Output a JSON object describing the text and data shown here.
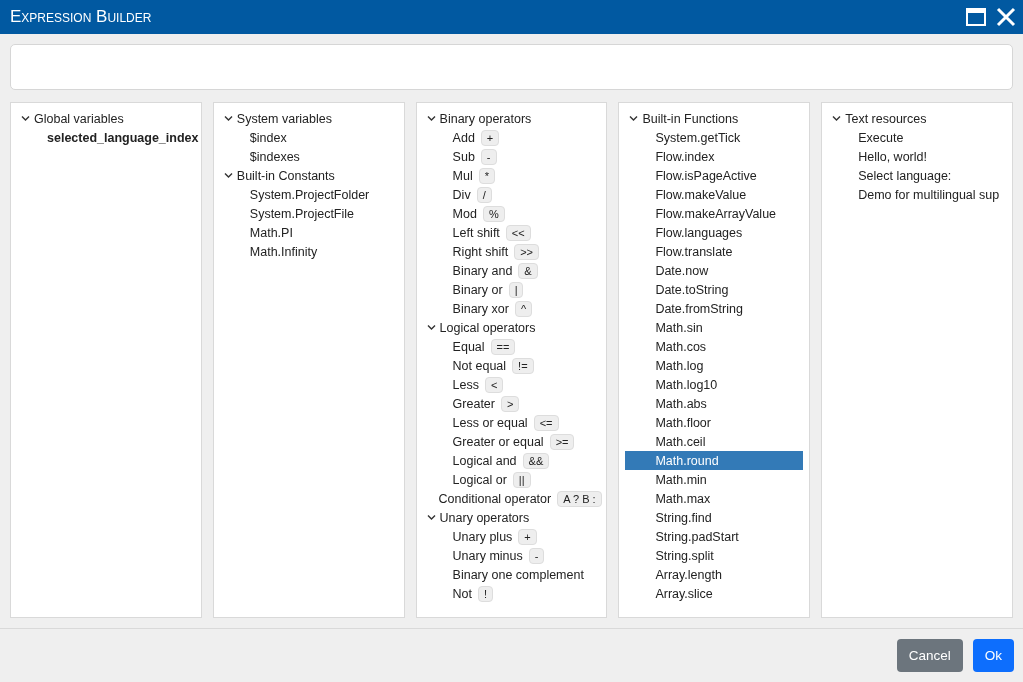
{
  "window": {
    "title": "Expression Builder"
  },
  "panels": [
    {
      "items": [
        {
          "label": "Global variables",
          "expanded": true,
          "children": [
            {
              "label": "selected_language_index",
              "kind": "variable",
              "selected": false
            }
          ]
        }
      ]
    },
    {
      "items": [
        {
          "label": "System variables",
          "expanded": true,
          "children": [
            {
              "label": "$index",
              "selected": false
            },
            {
              "label": "$indexes",
              "selected": false
            }
          ]
        },
        {
          "label": "Built-in Constants",
          "expanded": true,
          "children": [
            {
              "label": "System.ProjectFolder",
              "selected": false
            },
            {
              "label": "System.ProjectFile",
              "selected": false
            },
            {
              "label": "Math.PI",
              "selected": false
            },
            {
              "label": "Math.Infinity",
              "selected": false
            }
          ]
        }
      ]
    },
    {
      "items": [
        {
          "label": "Binary operators",
          "expanded": true,
          "children": [
            {
              "label": "Add",
              "operator": "+",
              "selected": false
            },
            {
              "label": "Sub",
              "operator": "-",
              "selected": false
            },
            {
              "label": "Mul",
              "operator": "*",
              "selected": false
            },
            {
              "label": "Div",
              "operator": "/",
              "selected": false
            },
            {
              "label": "Mod",
              "operator": "%",
              "selected": false
            },
            {
              "label": "Left shift",
              "operator": "<<",
              "selected": false
            },
            {
              "label": "Right shift",
              "operator": ">>",
              "selected": false
            },
            {
              "label": "Binary and",
              "operator": "&",
              "selected": false
            },
            {
              "label": "Binary or",
              "operator": "|",
              "selected": false
            },
            {
              "label": "Binary xor",
              "operator": "^",
              "selected": false
            }
          ]
        },
        {
          "label": "Logical operators",
          "expanded": true,
          "children": [
            {
              "label": "Equal",
              "operator": "==",
              "selected": false
            },
            {
              "label": "Not equal",
              "operator": "!=",
              "selected": false
            },
            {
              "label": "Less",
              "operator": "<",
              "selected": false
            },
            {
              "label": "Greater",
              "operator": ">",
              "selected": false
            },
            {
              "label": "Less or equal",
              "operator": "<=",
              "selected": false
            },
            {
              "label": "Greater or equal",
              "operator": ">=",
              "selected": false
            },
            {
              "label": "Logical and",
              "operator": "&&",
              "selected": false
            },
            {
              "label": "Logical or",
              "operator": "||",
              "selected": false
            }
          ]
        },
        {
          "label": "Conditional operator",
          "operator": "A ? B :",
          "selected": false
        },
        {
          "label": "Unary operators",
          "expanded": true,
          "children": [
            {
              "label": "Unary plus",
              "operator": "+",
              "selected": false
            },
            {
              "label": "Unary minus",
              "operator": "-",
              "selected": false
            },
            {
              "label": "Binary one complement",
              "selected": false
            },
            {
              "label": "Not",
              "operator": "!",
              "selected": false
            }
          ]
        }
      ]
    },
    {
      "items": [
        {
          "label": "Built-in Functions",
          "expanded": true,
          "children": [
            {
              "label": "System.getTick",
              "selected": false
            },
            {
              "label": "Flow.index",
              "selected": false
            },
            {
              "label": "Flow.isPageActive",
              "selected": false
            },
            {
              "label": "Flow.makeValue",
              "selected": false
            },
            {
              "label": "Flow.makeArrayValue",
              "selected": false
            },
            {
              "label": "Flow.languages",
              "selected": false
            },
            {
              "label": "Flow.translate",
              "selected": false
            },
            {
              "label": "Date.now",
              "selected": false
            },
            {
              "label": "Date.toString",
              "selected": false
            },
            {
              "label": "Date.fromString",
              "selected": false
            },
            {
              "label": "Math.sin",
              "selected": false
            },
            {
              "label": "Math.cos",
              "selected": false
            },
            {
              "label": "Math.log",
              "selected": false
            },
            {
              "label": "Math.log10",
              "selected": false
            },
            {
              "label": "Math.abs",
              "selected": false
            },
            {
              "label": "Math.floor",
              "selected": false
            },
            {
              "label": "Math.ceil",
              "selected": false
            },
            {
              "label": "Math.round",
              "selected": true
            },
            {
              "label": "Math.min",
              "selected": false
            },
            {
              "label": "Math.max",
              "selected": false
            },
            {
              "label": "String.find",
              "selected": false
            },
            {
              "label": "String.padStart",
              "selected": false
            },
            {
              "label": "String.split",
              "selected": false
            },
            {
              "label": "Array.length",
              "selected": false
            },
            {
              "label": "Array.slice",
              "selected": false
            }
          ]
        }
      ]
    },
    {
      "items": [
        {
          "label": "Text resources",
          "expanded": true,
          "children": [
            {
              "label": "Execute",
              "selected": false
            },
            {
              "label": "Hello, world!",
              "selected": false
            },
            {
              "label": "Select language:",
              "selected": false
            },
            {
              "label": "Demo for multilingual sup",
              "selected": false
            }
          ]
        }
      ]
    }
  ],
  "buttons": [
    {
      "label": "Cancel",
      "kind": "secondary"
    },
    {
      "label": "Ok",
      "kind": "primary"
    }
  ]
}
